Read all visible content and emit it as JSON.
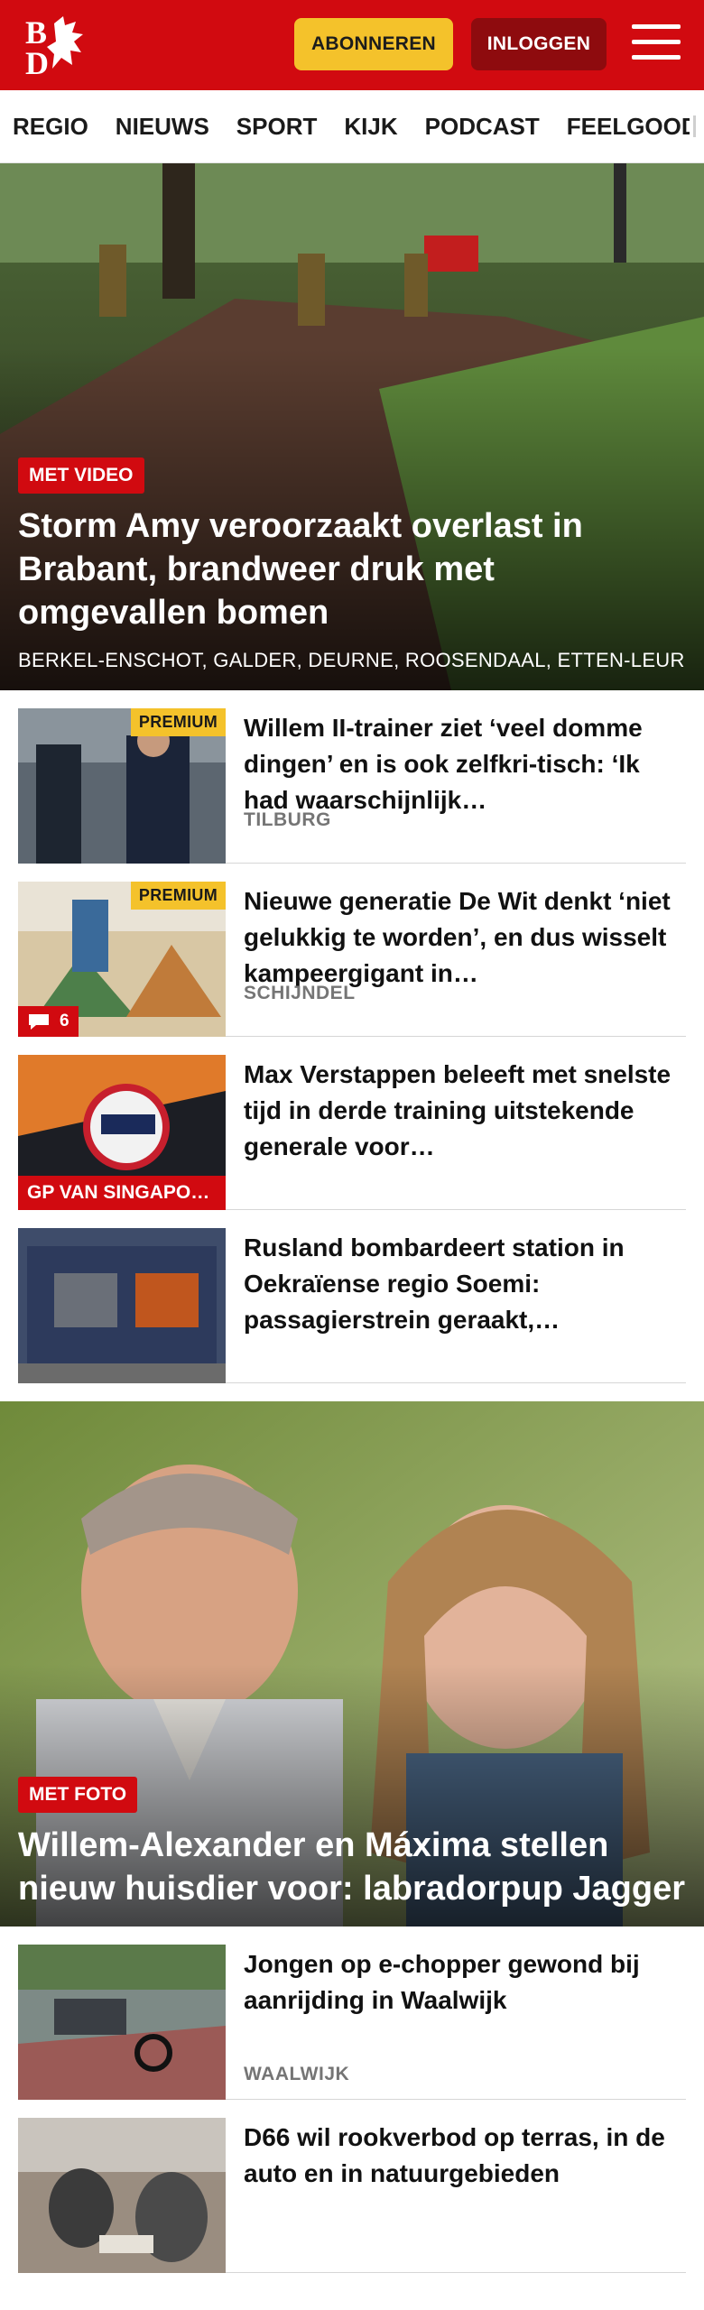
{
  "header": {
    "logo_alt": "BD",
    "subscribe_label": "ABONNEREN",
    "login_label": "INLOGGEN"
  },
  "nav": {
    "items": [
      "REGIO",
      "NIEUWS",
      "SPORT",
      "KIJK",
      "PODCAST",
      "FEELGOOD"
    ]
  },
  "hero": {
    "badge": "MET VIDEO",
    "title": "Storm Amy veroorzaakt overlast in Brabant, brandweer druk met omgevallen bomen",
    "tags": "BERKEL-ENSCHOT, GALDER, DEURNE, ROOSENDAAL, ETTEN-LEUR"
  },
  "articles": [
    {
      "title": "Willem II-trainer ziet ‘veel domme dingen’ en is ook zelfkri-tisch: ‘Ik had waarschijnlijk…",
      "place": "TILBURG",
      "premium": "PREMIUM"
    },
    {
      "title": "Nieuwe generatie De Wit denkt ‘niet gelukkig te worden’, en dus wisselt kampeergigant in…",
      "place": "SCHIJNDEL",
      "premium": "PREMIUM",
      "comments": "6"
    },
    {
      "title": "Max Verstappen beleeft met snelste tijd in derde training uitstekende generale voor…",
      "category": "GP VAN SINGAPORE"
    },
    {
      "title": "Rusland bombardeert station in Oekraïense regio Soemi: passagierstrein geraakt,…"
    }
  ],
  "feature": {
    "badge": "MET FOTO",
    "title": "Willem-Alexander en Máxima stellen nieuw huisdier voor: labradorpup Jagger"
  },
  "more_articles": [
    {
      "title": "Jongen op e-chopper gewond bij aanrijding in Waalwijk",
      "place": "WAALWIJK"
    },
    {
      "title": "D66 wil rookverbod op terras, in de auto en in natuurgebieden"
    }
  ],
  "colors": {
    "brand_red": "#d10a10",
    "premium_yellow": "#f4c22b",
    "login_dark_red": "#8e0b0e"
  }
}
